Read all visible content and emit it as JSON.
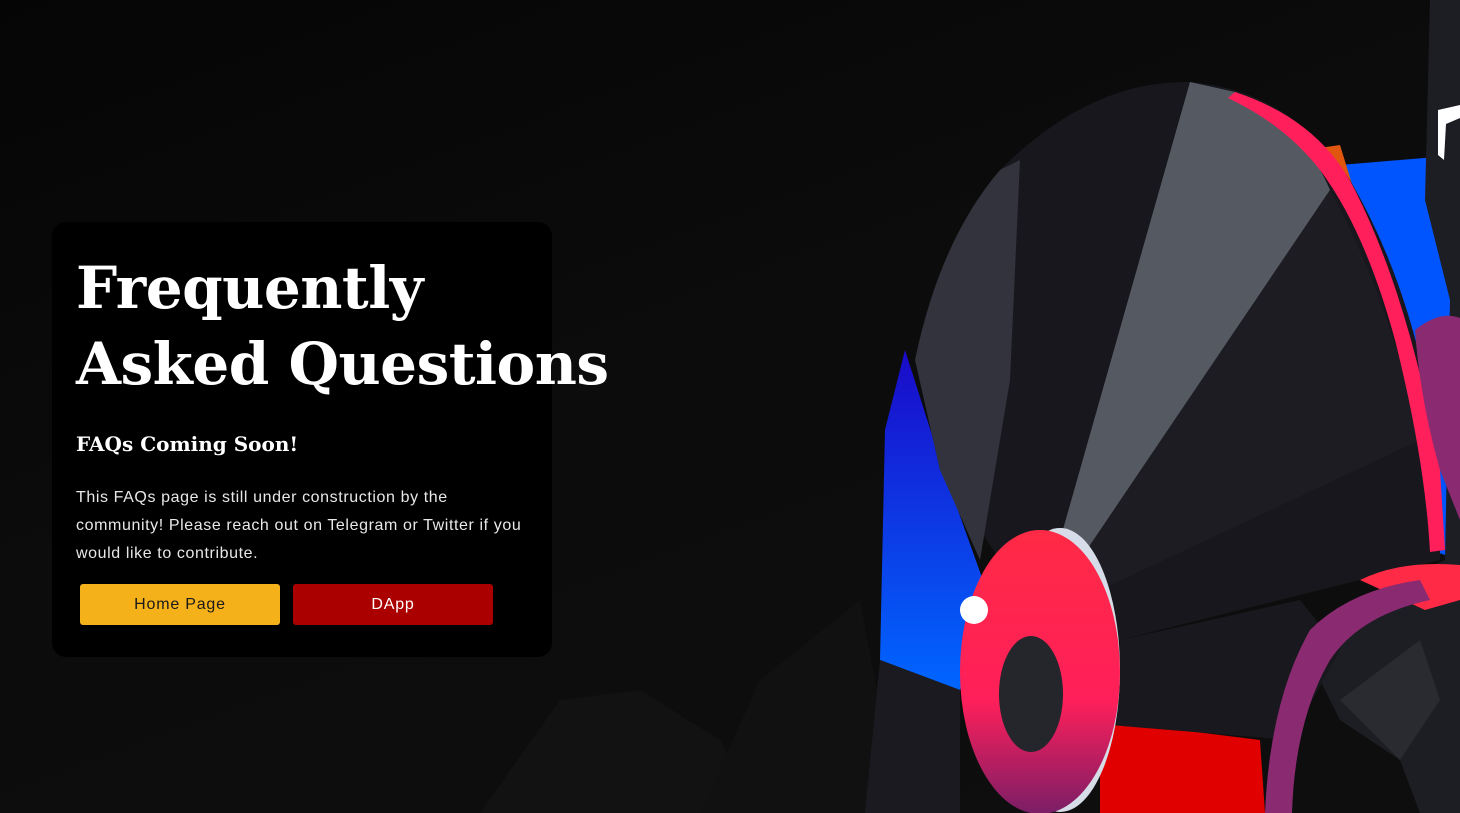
{
  "hero": {
    "title_line1": "Frequently",
    "title_line2": "Asked Questions",
    "subtitle": "FAQs Coming Soon!",
    "body": "This FAQs page is still under construction by the community! Please reach out on Telegram or Twitter if you would like to contribute."
  },
  "buttons": {
    "home_label": "Home Page",
    "dapp_label": "DApp"
  },
  "colors": {
    "page_bg": "#0a0a0a",
    "card_bg": "#000000",
    "home_button": "#f5b11a",
    "dapp_button": "#ab0000",
    "accent_pink": "#ff1f5a",
    "accent_blue": "#0066ff",
    "accent_red": "#e00000"
  },
  "icons": {
    "illustration": "character-headphones-illustration"
  }
}
